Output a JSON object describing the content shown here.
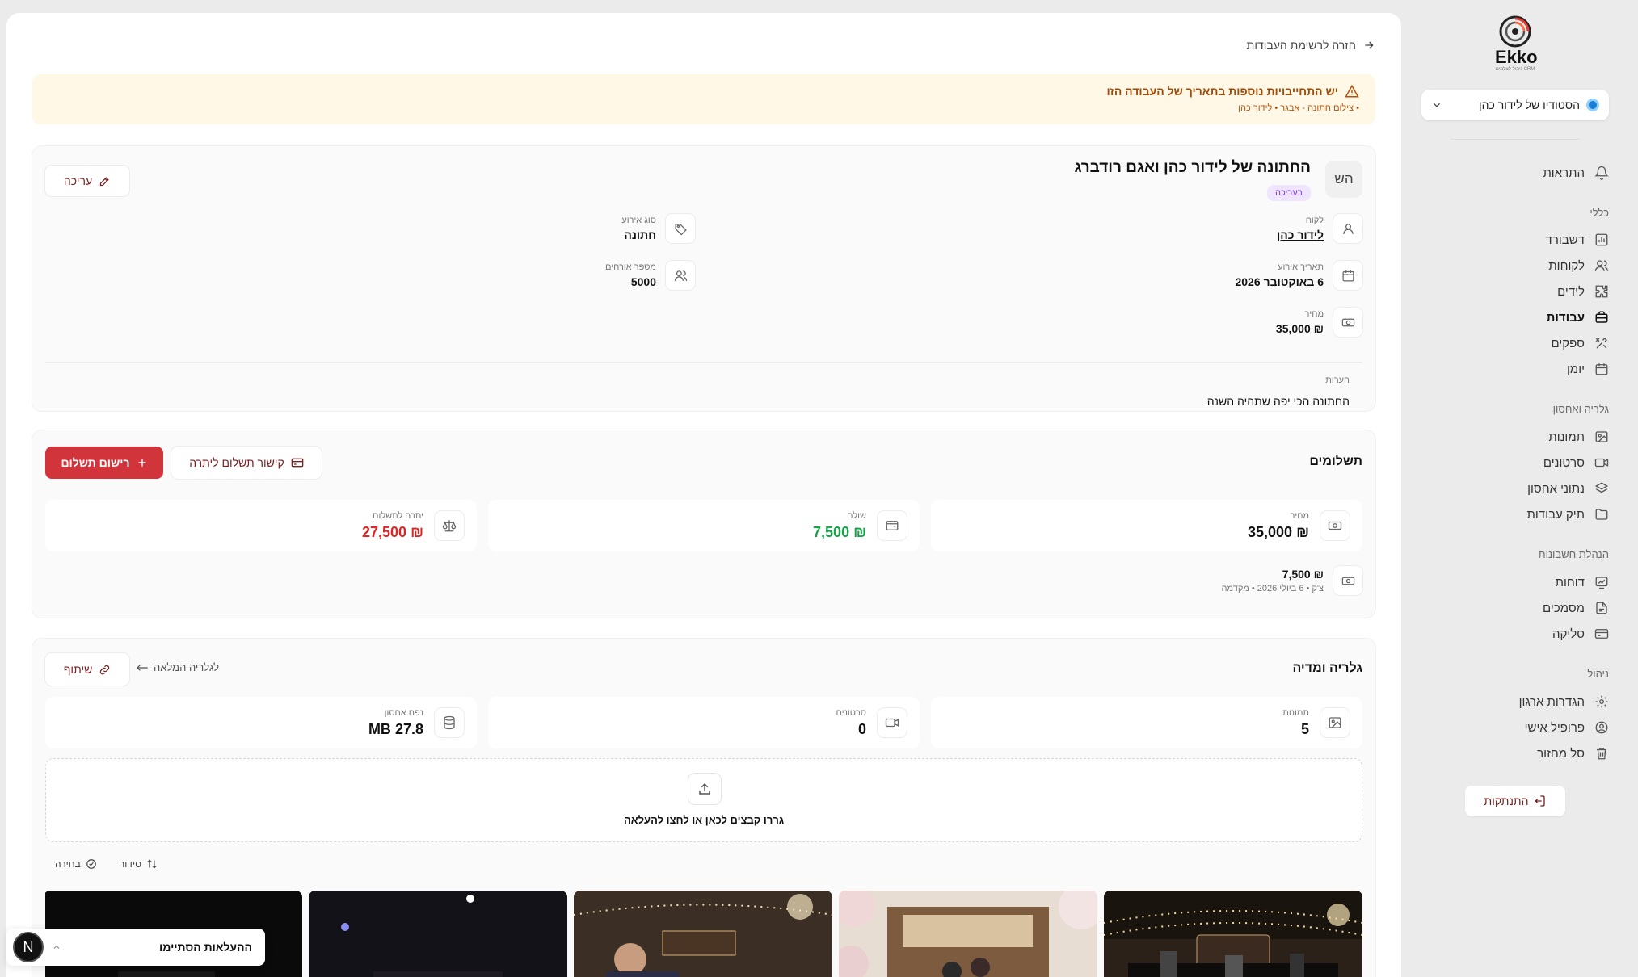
{
  "brand": {
    "name": "Ekko",
    "tagline": "CRM ניהול לצלמים"
  },
  "sidebar": {
    "studio_name": "הסטודיו של לידור כהן",
    "top": [
      {
        "label": "התראות"
      }
    ],
    "sections": [
      {
        "title": "כללי",
        "items": [
          {
            "label": "דשבורד"
          },
          {
            "label": "לקוחות"
          },
          {
            "label": "לידים"
          },
          {
            "label": "עבודות"
          },
          {
            "label": "ספקים"
          },
          {
            "label": "יומן"
          }
        ]
      },
      {
        "title": "גלריה ואחסון",
        "items": [
          {
            "label": "תמונות"
          },
          {
            "label": "סרטונים"
          },
          {
            "label": "נתוני אחסון"
          },
          {
            "label": "תיק עבודות"
          }
        ]
      },
      {
        "title": "הנהלת חשבונות",
        "items": [
          {
            "label": "דוחות"
          },
          {
            "label": "מסמכים"
          },
          {
            "label": "סליקה"
          }
        ]
      },
      {
        "title": "ניהול",
        "items": [
          {
            "label": "הגדרות ארגון"
          },
          {
            "label": "פרופיל אישי"
          },
          {
            "label": "סל מחזור"
          }
        ]
      }
    ],
    "logout": "התנתקות"
  },
  "back_link": "חזרה לרשימת העבודות",
  "warning": {
    "title": "יש התחייבויות נוספות בתאריך של העבודה הזו",
    "sub": "• צילום חתונה - אבגר • לידור כהן"
  },
  "job": {
    "initials": "הש",
    "title": "החתונה של לידור כהן ואגם רודברג",
    "status": "בעריכה",
    "edit": "עריכה",
    "client_label": "לקוח",
    "client": "לידור כהן",
    "event_type_label": "סוג אירוע",
    "event_type": "חתונה",
    "date_label": "תאריך אירוע",
    "date": "6 באוקטובר 2026",
    "guests_label": "מספר אורחים",
    "guests": "5000",
    "price_label": "מחיר",
    "price": "₪ 35,000",
    "notes_label": "הערות",
    "notes": "החתונה הכי יפה שתהיה השנה"
  },
  "payments": {
    "title": "תשלומים",
    "add": "רישום תשלום",
    "link": "קישור תשלום ליתרה",
    "price_label": "מחיר",
    "price": "₪ 35,000",
    "paid_label": "שולם",
    "paid": "₪ 7,500",
    "balance_label": "יתרה לתשלום",
    "balance": "₪ 27,500",
    "entry_amount": "₪ 7,500",
    "entry_detail": "צ'ק • 6 ביולי 2026 • מקדמה"
  },
  "gallery": {
    "title": "גלריה ומדיה",
    "share": "שיתוף",
    "full": "לגלריה המלאה",
    "photos_label": "תמונות",
    "photos": "5",
    "videos_label": "סרטונים",
    "videos": "0",
    "storage_label": "נפח אחסון",
    "storage": "27.8 MB",
    "drop": "גררו קבצים לכאן או לחצו להעלאה",
    "sort": "סידור",
    "select": "בחירה"
  },
  "toast": {
    "avatar": "N",
    "text": "ההעלאות הסתיימו"
  }
}
